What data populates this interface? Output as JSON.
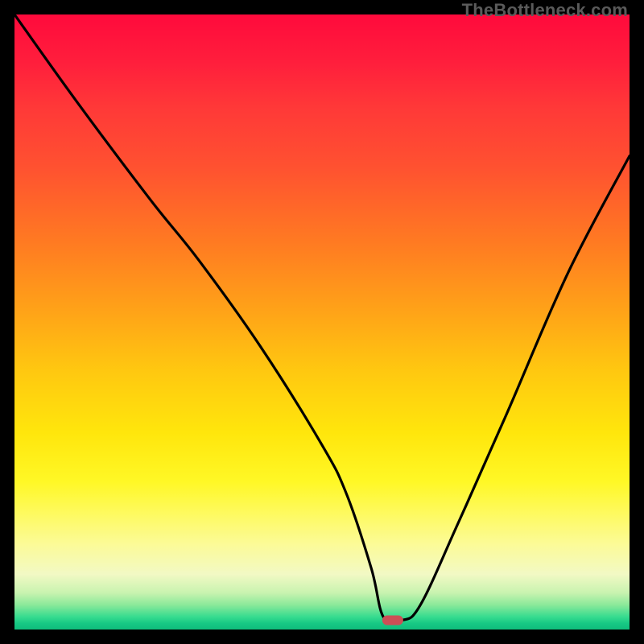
{
  "watermark": "TheBottleneck.com",
  "colors": {
    "frame": "#000000",
    "curve_stroke": "#000000",
    "marker_fill": "#cc4f56"
  },
  "chart_data": {
    "type": "line",
    "title": "",
    "xlabel": "",
    "ylabel": "",
    "xlim": [
      0,
      100
    ],
    "ylim": [
      0,
      100
    ],
    "grid": false,
    "annotations": [
      {
        "name": "min-marker",
        "x": 61.5,
        "y": 1.5,
        "shape": "rounded-rect",
        "color": "#cc4f56"
      }
    ],
    "series": [
      {
        "name": "bottleneck-curve",
        "x": [
          0,
          10,
          22,
          30,
          40,
          50,
          54,
          58,
          60,
          63,
          66,
          72,
          80,
          90,
          100
        ],
        "y": [
          100,
          86,
          70,
          60,
          46,
          30,
          22,
          10,
          2,
          1.5,
          4,
          17,
          35,
          58,
          77
        ]
      }
    ]
  }
}
